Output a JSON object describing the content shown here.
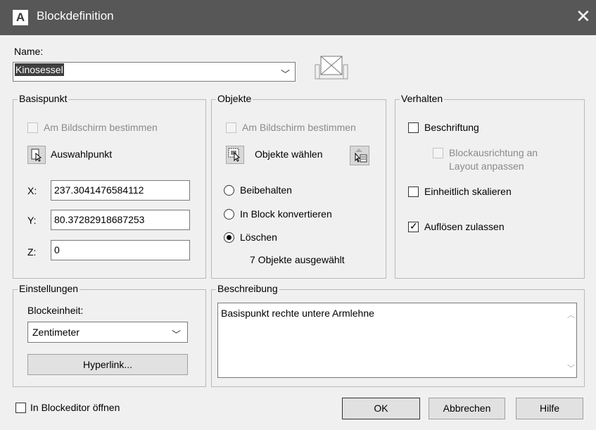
{
  "window": {
    "title": "Blockdefinition",
    "icon": "A",
    "close_glyph": "✕"
  },
  "name_field": {
    "label": "Name:",
    "value": "Kinosessel"
  },
  "basispunkt": {
    "title": "Basispunkt",
    "on_screen_label": "Am Bildschirm bestimmen",
    "pick_label": "Auswahlpunkt",
    "x_label": "X:",
    "x_value": "237.3041476584112",
    "y_label": "Y:",
    "y_value": "80.37282918687253",
    "z_label": "Z:",
    "z_value": "0"
  },
  "objekte": {
    "title": "Objekte",
    "on_screen_label": "Am Bildschirm bestimmen",
    "select_label": "Objekte wählen",
    "retain_label": "Beibehalten",
    "convert_label": "In Block konvertieren",
    "delete_label": "Löschen",
    "selected_option": "Löschen",
    "count_text": "7 Objekte ausgewählt"
  },
  "verhalten": {
    "title": "Verhalten",
    "annotative_label": "Beschriftung",
    "annotative_checked": false,
    "orientation_label_1": "Blockausrichtung an",
    "orientation_label_2": "Layout anpassen",
    "uniform_label": "Einheitlich skalieren",
    "uniform_checked": false,
    "explode_label": "Auflösen zulassen",
    "explode_checked": true
  },
  "einstellungen": {
    "title": "Einstellungen",
    "unit_label": "Blockeinheit:",
    "unit_value": "Zentimeter",
    "hyperlink_label": "Hyperlink..."
  },
  "beschreibung": {
    "title": "Beschreibung",
    "text": "Basispunkt rechte untere Armlehne"
  },
  "footer": {
    "open_editor_label": "In Blockeditor öffnen",
    "open_editor_checked": false,
    "ok_label": "OK",
    "cancel_label": "Abbrechen",
    "help_label": "Hilfe"
  },
  "colors": {
    "titlebar": "#575757",
    "dialog_bg": "#f0f0f0",
    "name_highlight": "#3f3f3f"
  }
}
